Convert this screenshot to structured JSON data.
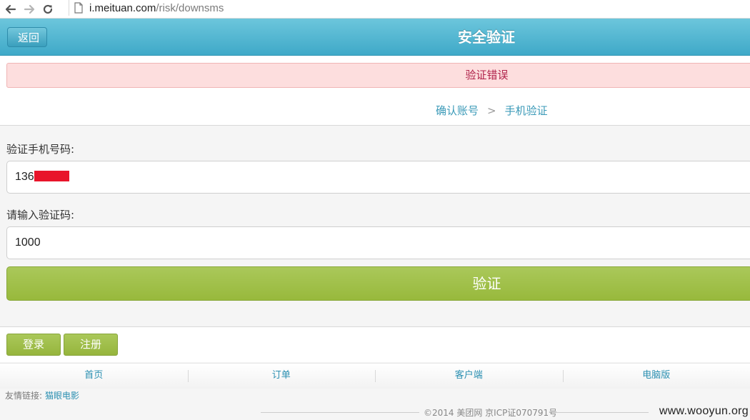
{
  "browser": {
    "url_host": "i.meituan.com",
    "url_path": "/risk/downsms"
  },
  "header": {
    "back_label": "返回",
    "title": "安全验证"
  },
  "error": {
    "message": "验证错误"
  },
  "steps": {
    "step1": "确认账号",
    "separator": ">",
    "step2": "手机验证"
  },
  "form": {
    "phone_label": "验证手机号码:",
    "phone_value": "136",
    "code_label": "请输入验证码:",
    "code_value": "1000",
    "submit_label": "验证"
  },
  "account": {
    "login_label": "登录",
    "register_label": "注册"
  },
  "footer": {
    "nav": [
      "首页",
      "订单",
      "客户端",
      "电脑版"
    ],
    "friend_links_label": "友情链接:",
    "friend_link": "猫眼电影",
    "copyright": "©2014 美团网 京ICP证070791号"
  },
  "watermark": "www.wooyun.org",
  "colors": {
    "header": "#3fa9c8",
    "error_bg": "#fddede",
    "error_text": "#b0224a",
    "button_green": "#a3c14b",
    "link_blue": "#2a8fb1",
    "redaction": "#e8142a"
  },
  "icons": {
    "back": "arrow-left-icon",
    "forward": "arrow-right-icon",
    "reload": "reload-icon",
    "page": "page-icon"
  }
}
